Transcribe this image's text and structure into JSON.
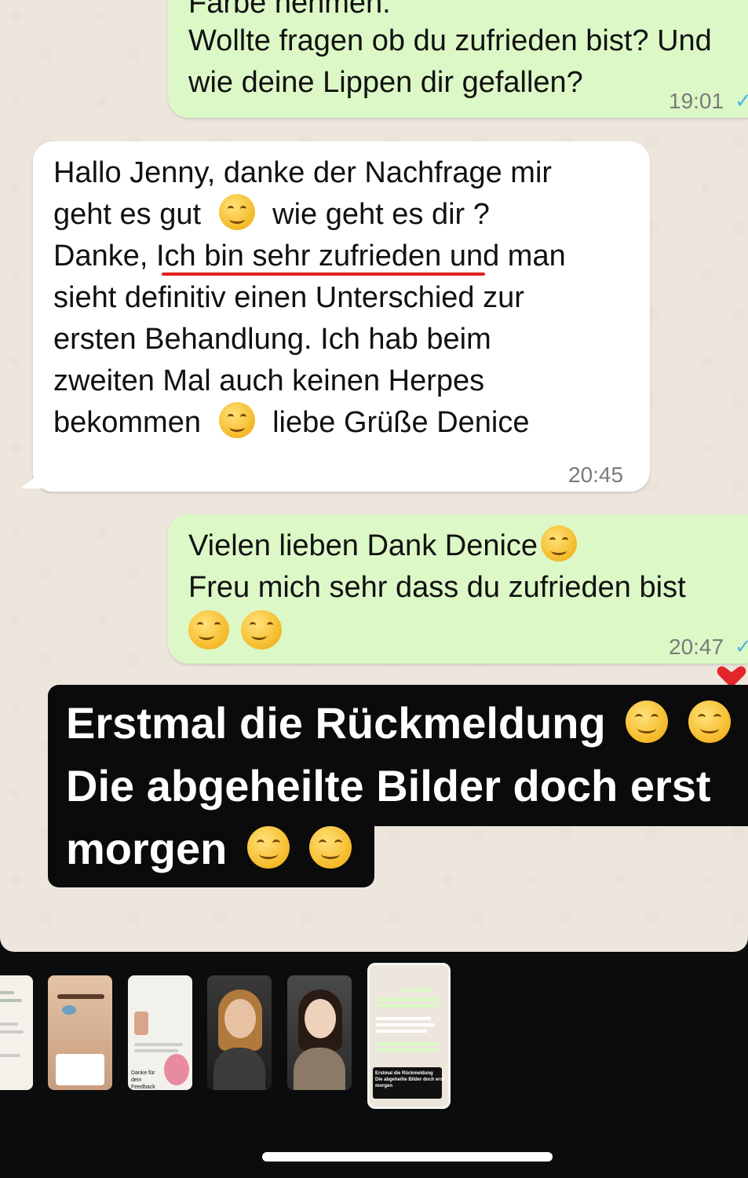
{
  "chat": {
    "msg1": {
      "line0": "Farbe nehmen.",
      "line1": "Wollte fragen ob du zufrieden bist? Und",
      "line2": "wie deine Lippen dir gefallen?",
      "time": "19:01"
    },
    "msg2": {
      "line1a": "Hallo Jenny, danke der Nachfrage mir",
      "line2a": "geht es gut",
      "line2b": "wie geht es dir ?",
      "line3": "Danke, Ich bin sehr zufrieden und man",
      "line4": "sieht definitiv einen Unterschied zur",
      "line5": "ersten Behandlung. Ich hab beim",
      "line6": "zweiten Mal auch keinen Herpes",
      "line7a": "bekommen",
      "line7b": "liebe Grüße Denice",
      "time": "20:45"
    },
    "msg3": {
      "line1": "Vielen lieben Dank Denice",
      "line2": "Freu mich sehr dass du zufrieden bist",
      "time": "20:47"
    },
    "reaction": "heart"
  },
  "caption": {
    "line1": "Erstmal die Rückmeldung",
    "line2": "Die abgeheilte Bilder doch erst",
    "line3": "morgen"
  },
  "thumbnails": {
    "t2_label": "Danke für dein Feedback",
    "t5_line1": "Erstmal die Rückmeldung",
    "t5_line2": "Die abgeheilte Bilder doch erst",
    "t5_line3": "morgen"
  },
  "colors": {
    "outgoing": "#dcf8c6",
    "incoming": "#ffffff",
    "underline": "#e0201f",
    "tick": "#4fb3e6"
  }
}
